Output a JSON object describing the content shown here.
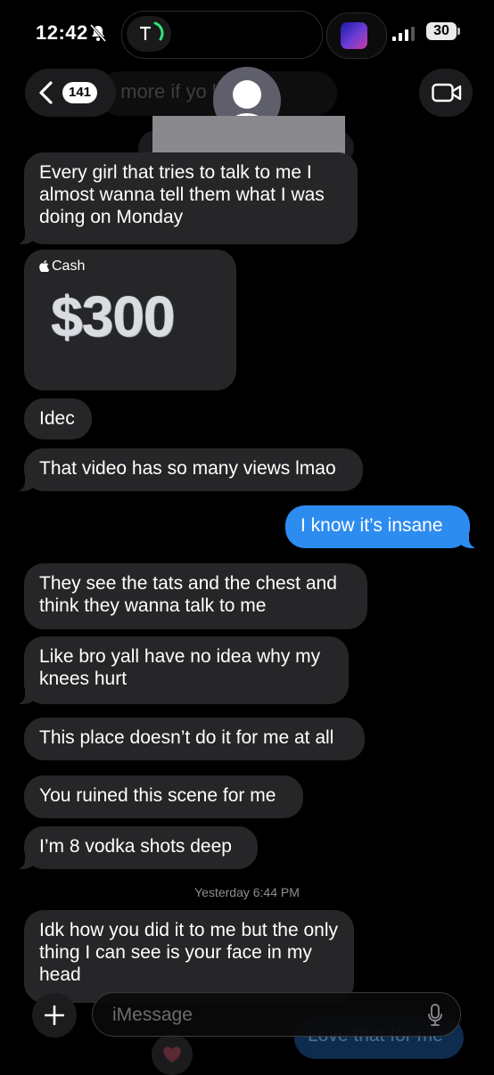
{
  "status_bar": {
    "time": "12:42",
    "battery": "30"
  },
  "header": {
    "back_count": "141",
    "ghost_text": "it more if yo      here"
  },
  "messages": [
    {
      "dir": "received",
      "text": "Every girl that tries to talk to me I almost wanna tell them what I was doing on Monday"
    },
    {
      "dir": "received",
      "type": "apple-cash",
      "label": "Cash",
      "amount": "$300"
    },
    {
      "dir": "received",
      "text": "Idec"
    },
    {
      "dir": "received",
      "text": "That video has so many views lmao"
    },
    {
      "dir": "sent",
      "text": "I know it’s insane"
    },
    {
      "dir": "received",
      "text": "They see the tats and the chest and think they wanna talk to me"
    },
    {
      "dir": "received",
      "text": "Like bro yall have no idea why my knees hurt"
    },
    {
      "dir": "received",
      "text": "This place doesn’t do it for me at all"
    },
    {
      "dir": "received",
      "text": "You ruined this scene for me"
    },
    {
      "dir": "received",
      "text": "I’m 8 vodka shots deep"
    },
    {
      "dir": "received",
      "text": "Idk how you did it to me but the only thing I can see is your face in my head"
    }
  ],
  "timestamp": {
    "day": "Yesterday",
    "time": "6:44 PM"
  },
  "composer": {
    "placeholder": "iMessage"
  },
  "ghost_sent_text": "Love that for me",
  "colors": {
    "sent_bubble": "#2d8cf0",
    "received_bubble": "#262628",
    "background": "#000000"
  },
  "icons": [
    "bell-slash-icon",
    "tesla-logo-icon",
    "signal-icon",
    "chevron-left-icon",
    "avatar-icon",
    "video-camera-icon",
    "apple-logo-icon",
    "plus-icon",
    "microphone-icon",
    "heart-icon"
  ]
}
